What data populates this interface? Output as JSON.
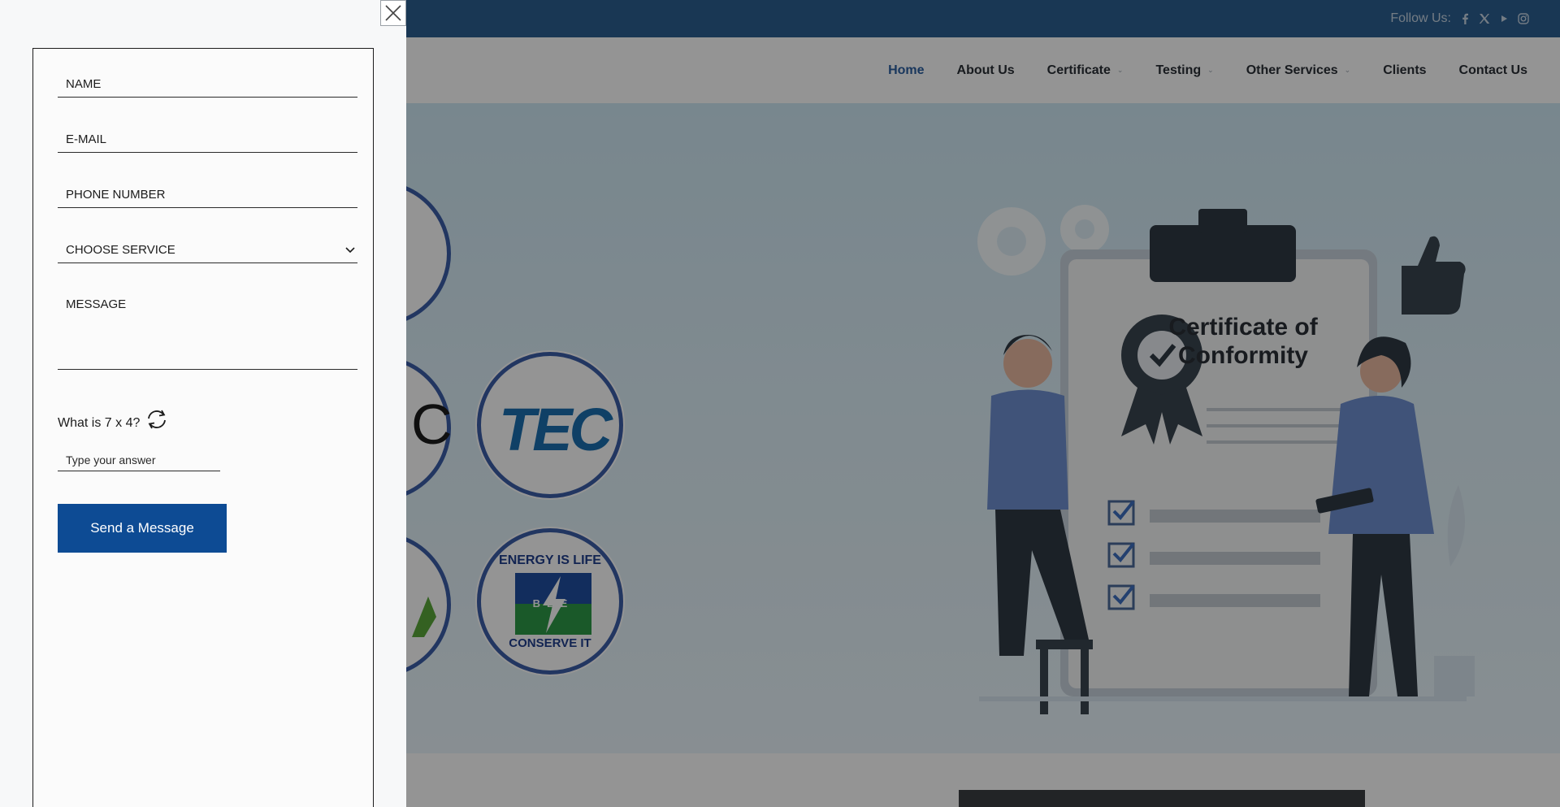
{
  "topbar": {
    "follow_label": "Follow Us:",
    "social_icons": [
      "facebook-icon",
      "x-twitter-icon",
      "youtube-icon",
      "instagram-icon"
    ]
  },
  "nav": {
    "items": [
      {
        "label": "Home",
        "active": true,
        "has_dropdown": false
      },
      {
        "label": "About Us",
        "active": false,
        "has_dropdown": false
      },
      {
        "label": "Certificate",
        "active": false,
        "has_dropdown": true
      },
      {
        "label": "Testing",
        "active": false,
        "has_dropdown": true
      },
      {
        "label": "Other Services",
        "active": false,
        "has_dropdown": true
      },
      {
        "label": "Clients",
        "active": false,
        "has_dropdown": false
      },
      {
        "label": "Contact Us",
        "active": false,
        "has_dropdown": false
      }
    ]
  },
  "hero": {
    "badges": {
      "tec": "TEC",
      "bee_top": "ENERGY IS LIFE",
      "bee_letters": "BEE",
      "bee_bottom": "CONSERVE IT",
      "partial_letter": "C"
    },
    "illustration": {
      "certificate_line1": "Certificate of",
      "certificate_line2": "Conformity"
    }
  },
  "form": {
    "name_placeholder": "NAME",
    "email_placeholder": "E-MAIL",
    "phone_placeholder": "PHONE NUMBER",
    "service_selected": "CHOOSE SERVICE",
    "message_placeholder": "MESSAGE",
    "captcha_question": "What is 7 x 4?",
    "captcha_placeholder": "Type your answer",
    "submit_label": "Send a Message"
  },
  "colors": {
    "topbar": "#2b5f91",
    "nav_active": "#2c5fa0",
    "submit_button": "#0d4b94",
    "overlay": "rgba(0,0,0,0.42)"
  }
}
